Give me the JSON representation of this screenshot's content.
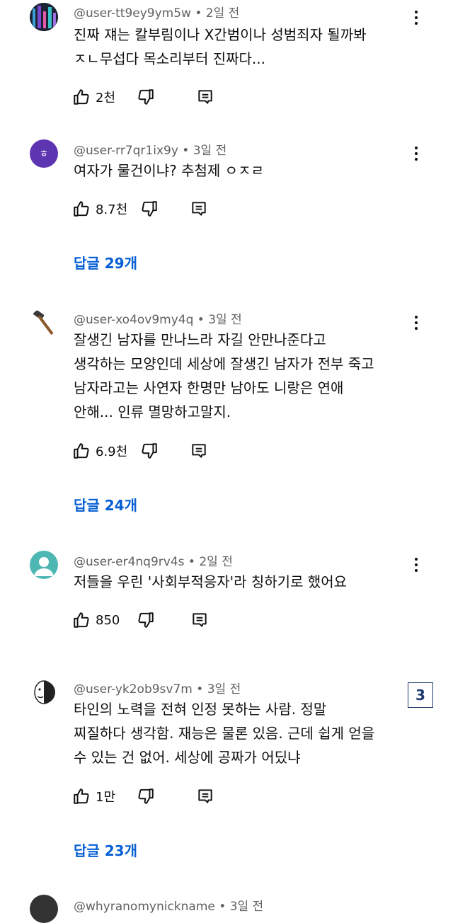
{
  "comments": [
    {
      "handle": "@user-tt9ey9ym5w",
      "time": "2일 전",
      "text": "진짜 쟤는 칼부림이나 X간범이나 성범죄자 될까봐\nㅈㄴ무섭다 목소리부터 진짜다...",
      "likes": "2천",
      "avatar_icon": "neon-city-avatar-icon"
    },
    {
      "handle": "@user-rr7qr1ix9y",
      "time": "3일 전",
      "text": "여자가 물건이냐? 추첨제 ㅇㅈㄹ",
      "likes": "8.7천",
      "avatar_letter": "ㅎ",
      "avatar_color": "#5e35b1",
      "replies": "답글 29개"
    },
    {
      "handle": "@user-xo4ov9my4q",
      "time": "3일 전",
      "text": "잘생긴 남자를 만나느라 자길 안만나준다고\n생각하는 모양인데 세상에 잘생긴 남자가 전부 죽고\n남자라고는 사연자 한명만 남아도 니랑은 연애\n안해... 인류 멸망하고말지.",
      "likes": "6.9천",
      "avatar_icon": "hammer-avatar-icon",
      "replies": "답글 24개"
    },
    {
      "handle": "@user-er4nq9rv4s",
      "time": "2일 전",
      "text": "저들을 우린 '사회부적응자'라 칭하기로 했어요",
      "likes": "850",
      "avatar_icon": "default-person-avatar-icon",
      "avatar_color": "#4fb7b3"
    },
    {
      "handle": "@user-yk2ob9sv7m",
      "time": "3일 전",
      "text": "타인의 노력을 전혀 인정 못하는 사람. 정말\n찌질하다 생각함. 재능은 물론 있음. 근데 쉽게 얻을\n수 있는 건 없어. 세상에 공짜가 어딨냐",
      "likes": "1만",
      "avatar_icon": "sketch-face-avatar-icon",
      "replies": "답글 23개"
    },
    {
      "handle": "@whyranomynickname",
      "time": "3일 전"
    }
  ],
  "badge": "3",
  "colors": {
    "link": "#065fd4",
    "meta": "#606060",
    "text": "#0f0f0f"
  }
}
